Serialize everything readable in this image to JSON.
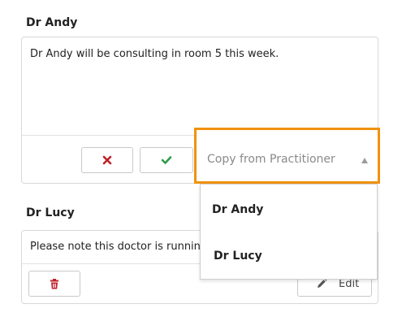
{
  "practitioners": [
    {
      "name": "Dr Andy",
      "note": "Dr Andy will be consulting in room 5 this week."
    },
    {
      "name": "Dr Lucy",
      "note": "Please note this doctor is running late today."
    }
  ],
  "copy_select": {
    "placeholder": "Copy from Practitioner",
    "options": [
      "Dr Andy",
      "Dr Lucy"
    ]
  },
  "edit_label": "Edit",
  "colors": {
    "highlight": "#f0920f",
    "cancel_red": "#c0202a",
    "confirm_green": "#2a9d4a"
  },
  "icons": {
    "cancel": "x-icon",
    "confirm": "check-icon",
    "delete": "trash-icon",
    "edit": "pencil-icon",
    "dropdown": "triangle-up-icon"
  }
}
